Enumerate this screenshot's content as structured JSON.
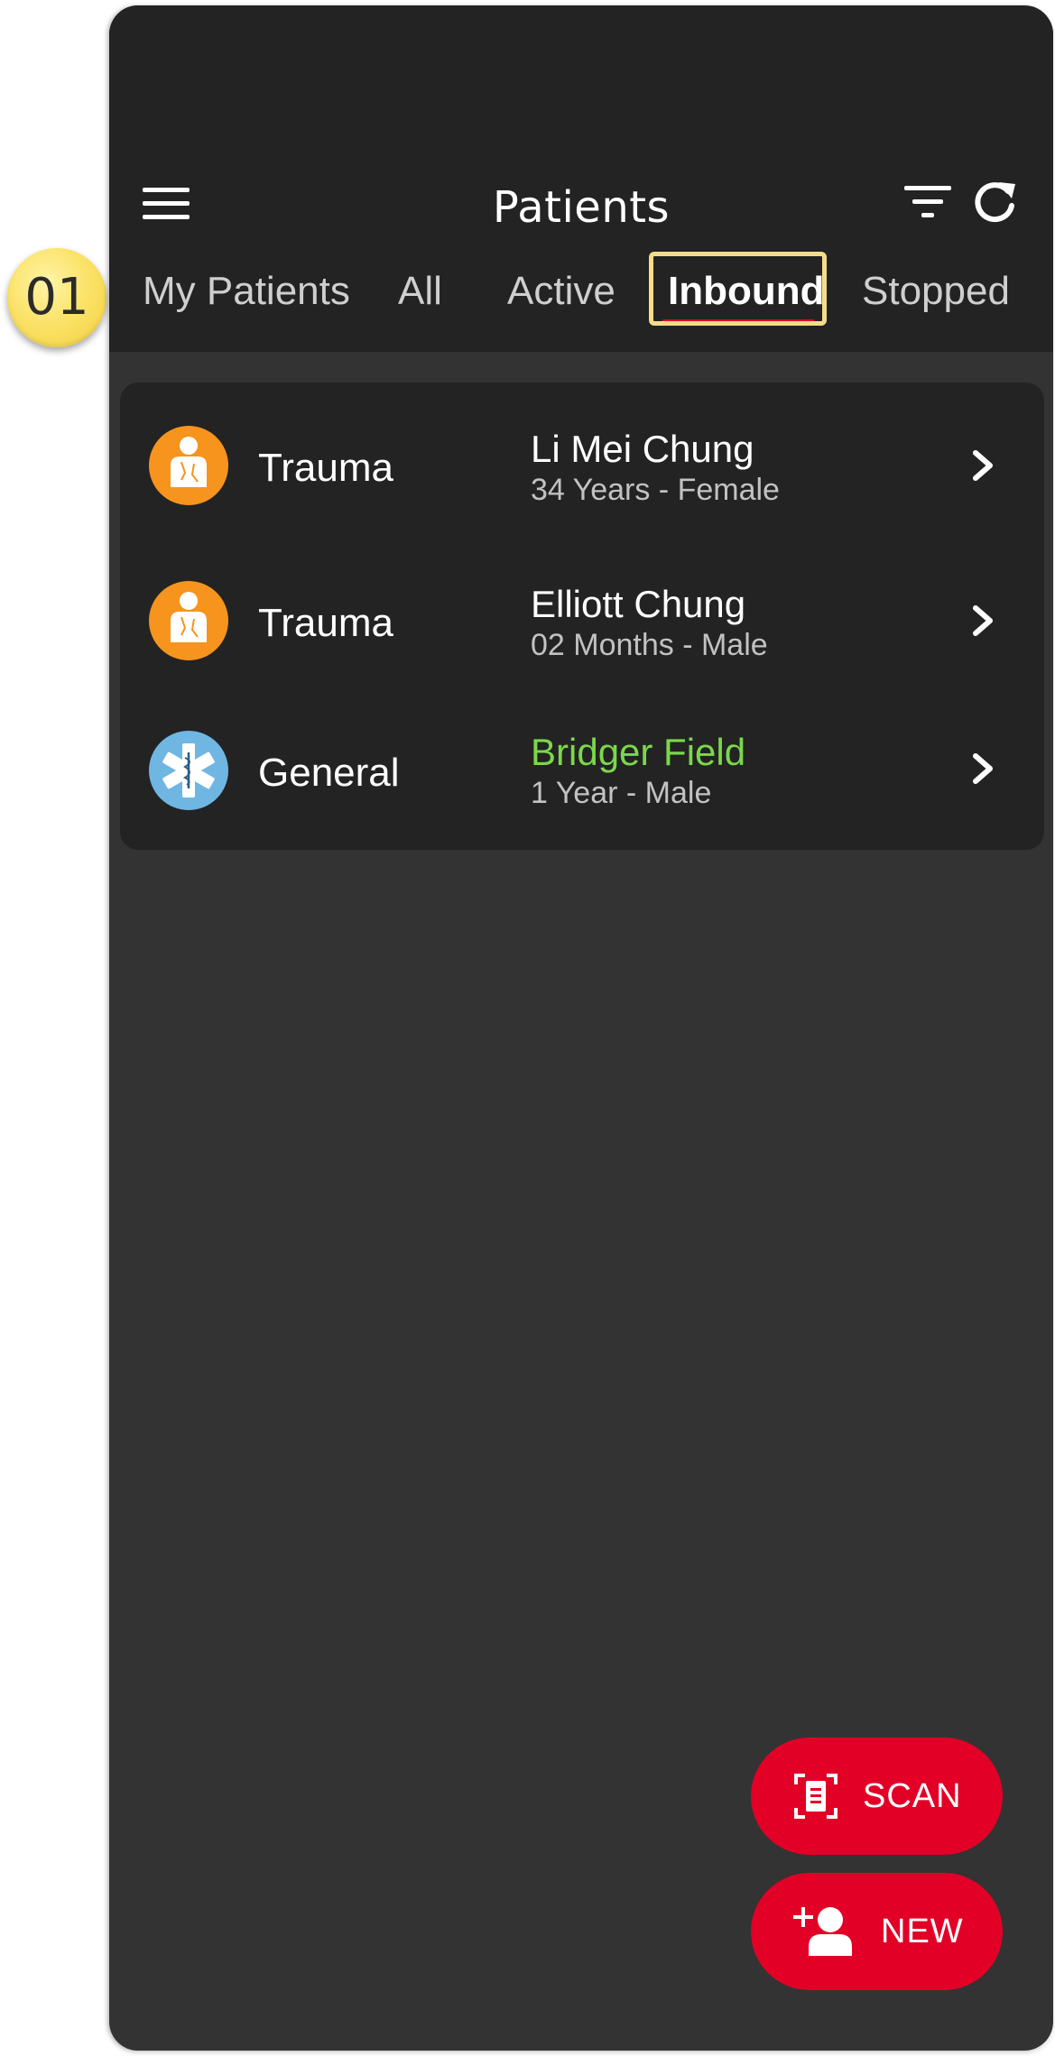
{
  "header": {
    "title": "Patients",
    "menu_icon": "hamburger-icon",
    "filter_icon": "filter-icon",
    "refresh_icon": "refresh-icon"
  },
  "tabs": [
    {
      "label": "My Patients",
      "active": false
    },
    {
      "label": "All",
      "active": false
    },
    {
      "label": "Active",
      "active": false
    },
    {
      "label": "Inbound",
      "active": true
    },
    {
      "label": "Stopped",
      "active": false
    }
  ],
  "callout": {
    "label": "01"
  },
  "patients": [
    {
      "category": "Trauma",
      "category_icon": "trauma-person-icon",
      "name": "Li Mei Chung",
      "detail": "34 Years - Female"
    },
    {
      "category": "Trauma",
      "category_icon": "trauma-person-icon",
      "name": "Elliott Chung",
      "detail": "02 Months - Male"
    },
    {
      "category": "General",
      "category_icon": "star-of-life-icon",
      "name": "Bridger Field",
      "detail": "1 Year - Male"
    }
  ],
  "actions": {
    "scan_label": "SCAN",
    "new_label": "NEW"
  },
  "colors": {
    "accent": "#e30026",
    "background": "#333333",
    "surface": "#232323",
    "trauma": "#f7941d",
    "general": "#6fb6e3",
    "highlight_name": "#7bd84a",
    "callout_border": "#f6dc8a"
  }
}
